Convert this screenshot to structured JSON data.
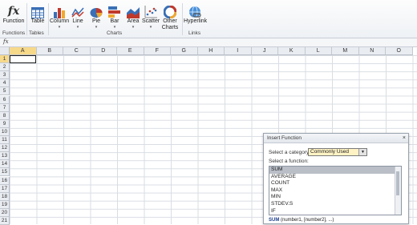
{
  "ribbon": {
    "buttons": [
      {
        "id": "function",
        "label": "Function",
        "has_dropdown": false,
        "icon": "fx-icon"
      },
      {
        "id": "table",
        "label": "Table",
        "has_dropdown": false,
        "icon": "table-icon"
      },
      {
        "id": "column",
        "label": "Column",
        "has_dropdown": true,
        "icon": "column-chart-icon"
      },
      {
        "id": "line",
        "label": "Line",
        "has_dropdown": true,
        "icon": "line-chart-icon"
      },
      {
        "id": "pie",
        "label": "Pie",
        "has_dropdown": true,
        "icon": "pie-chart-icon"
      },
      {
        "id": "bar",
        "label": "Bar",
        "has_dropdown": true,
        "icon": "bar-chart-icon"
      },
      {
        "id": "area",
        "label": "Area",
        "has_dropdown": true,
        "icon": "area-chart-icon"
      },
      {
        "id": "scatter",
        "label": "Scatter",
        "has_dropdown": true,
        "icon": "scatter-chart-icon"
      },
      {
        "id": "other",
        "label": "Other Charts",
        "has_dropdown": true,
        "icon": "other-charts-icon"
      },
      {
        "id": "hyperlink",
        "label": "Hyperlink",
        "has_dropdown": false,
        "icon": "hyperlink-icon"
      }
    ],
    "groups": {
      "functions": "Functions",
      "tables": "Tables",
      "charts": "Charts",
      "links": "Links"
    }
  },
  "formula_bar": {
    "fx": "fx"
  },
  "grid": {
    "columns": [
      "A",
      "B",
      "C",
      "D",
      "E",
      "F",
      "G",
      "H",
      "I",
      "J",
      "K",
      "L",
      "M",
      "N",
      "O"
    ],
    "rows": [
      "1",
      "2",
      "3",
      "4",
      "5",
      "6",
      "7",
      "8",
      "9",
      "10",
      "11",
      "12",
      "13",
      "14",
      "15",
      "16",
      "17",
      "18",
      "19",
      "20",
      "21"
    ],
    "active_cell": "A1"
  },
  "dialog": {
    "title": "Insert Function",
    "close": "×",
    "category_label": "Select a category:",
    "category_value": "Commonly Used",
    "function_label": "Select a function:",
    "functions": [
      "SUM",
      "AVERAGE",
      "COUNT",
      "MAX",
      "MIN",
      "STDEV.S",
      "IF"
    ],
    "selected_function": "SUM",
    "signature_name": "SUM",
    "signature_args": " (number1, [number2], ...)"
  },
  "colors": {
    "accent": "#f7d98a",
    "selection": "#b9bec7"
  }
}
